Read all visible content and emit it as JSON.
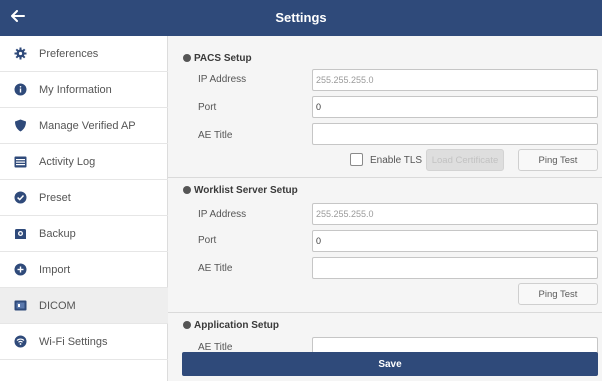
{
  "header": {
    "title": "Settings",
    "back_icon": "arrow-left-icon"
  },
  "sidebar": {
    "items": [
      {
        "label": "Preferences",
        "icon": "gear-icon"
      },
      {
        "label": "My Information",
        "icon": "info-icon"
      },
      {
        "label": "Manage Verified AP",
        "icon": "shield-icon"
      },
      {
        "label": "Activity Log",
        "icon": "list-icon"
      },
      {
        "label": "Preset",
        "icon": "check-circle-icon"
      },
      {
        "label": "Backup",
        "icon": "backup-icon"
      },
      {
        "label": "Import",
        "icon": "plus-circle-icon"
      },
      {
        "label": "DICOM",
        "icon": "dicom-icon",
        "active": true
      },
      {
        "label": "Wi-Fi Settings",
        "icon": "wifi-icon"
      }
    ]
  },
  "pacs": {
    "title": "PACS Setup",
    "ip_label": "IP Address",
    "ip_placeholder": "255.255.255.0",
    "port_label": "Port",
    "port_value": "0",
    "ae_label": "AE Title",
    "ae_value": "",
    "tls_label": "Enable TLS",
    "tls_checked": false,
    "load_cert_label": "Load Certificate",
    "ping_label": "Ping Test"
  },
  "worklist": {
    "title": "Worklist Server Setup",
    "ip_label": "IP Address",
    "ip_placeholder": "255.255.255.0",
    "port_label": "Port",
    "port_value": "0",
    "ae_label": "AE Title",
    "ae_value": "",
    "ping_label": "Ping Test"
  },
  "application": {
    "title": "Application Setup",
    "ae_label": "AE Title"
  },
  "save_label": "Save",
  "colors": {
    "header": "#2f4a7a",
    "icon": "#2f4a7a",
    "content_bg": "#f5f5f5"
  }
}
